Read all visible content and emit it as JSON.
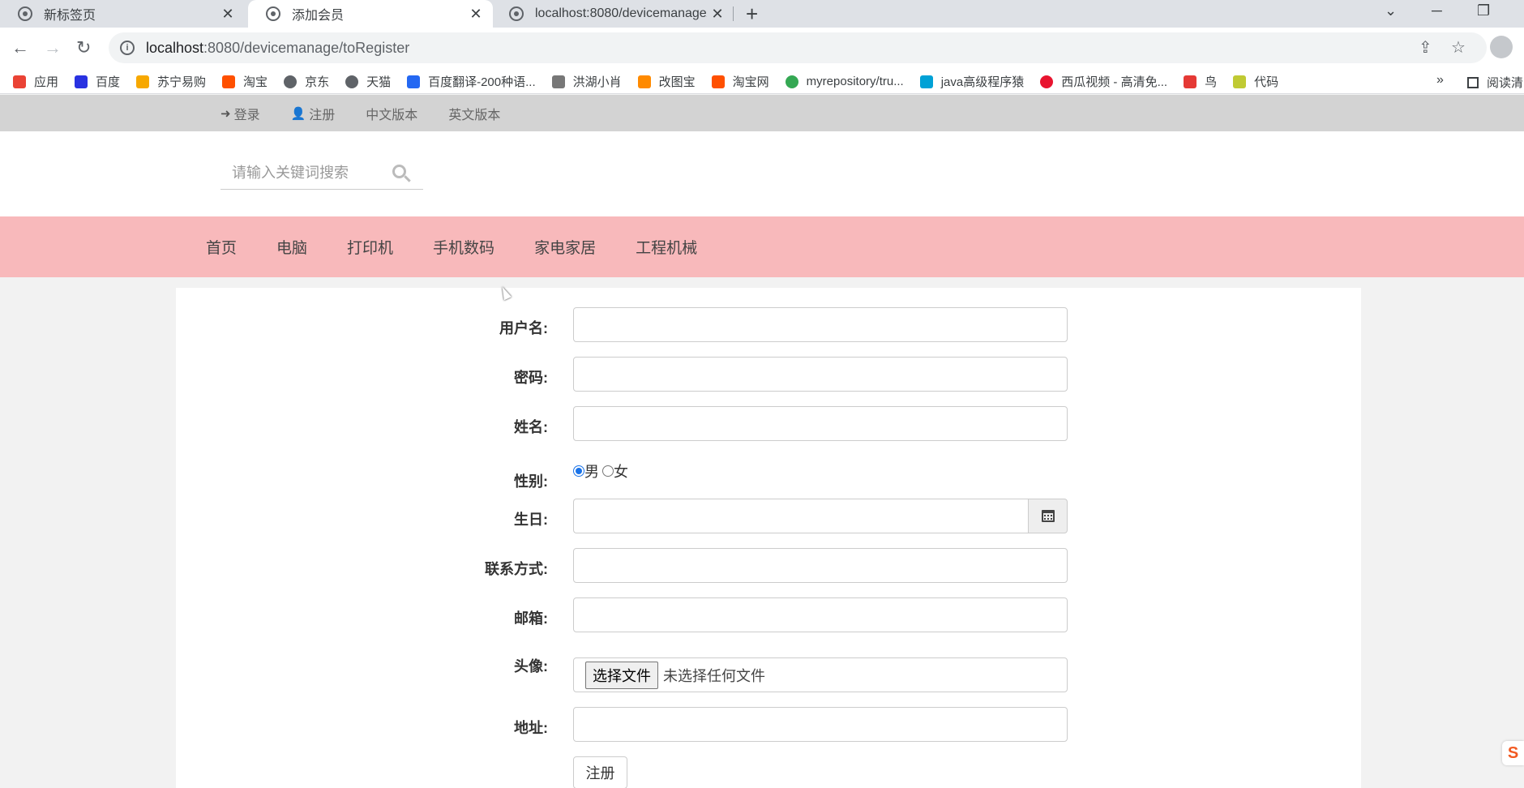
{
  "browser": {
    "tabs": [
      {
        "title": "新标签页",
        "active": false
      },
      {
        "title": "添加会员",
        "active": true
      },
      {
        "title": "localhost:8080/devicemanage/",
        "active": false
      }
    ],
    "url_host": "localhost",
    "url_rest": ":8080/devicemanage/toRegister",
    "bookmarks": [
      {
        "label": "应用",
        "icon": "apps-icon",
        "color": "#ea4335"
      },
      {
        "label": "百度",
        "icon": "baidu-icon",
        "color": "#2932e1"
      },
      {
        "label": "苏宁易购",
        "icon": "suning-icon",
        "color": "#f7a800"
      },
      {
        "label": "淘宝",
        "icon": "taobao-icon",
        "color": "#ff5000"
      },
      {
        "label": "京东",
        "icon": "globe-icon",
        "color": "#5f6368"
      },
      {
        "label": "天猫",
        "icon": "globe-icon",
        "color": "#5f6368"
      },
      {
        "label": "百度翻译-200种语...",
        "icon": "translate-icon",
        "color": "#2468f2"
      },
      {
        "label": "洪湖小肖",
        "icon": "feather-icon",
        "color": "#777777"
      },
      {
        "label": "改图宝",
        "icon": "gaitubao-icon",
        "color": "#ff8a00"
      },
      {
        "label": "淘宝网",
        "icon": "taobao-icon",
        "color": "#ff5000"
      },
      {
        "label": "myrepository/tru...",
        "icon": "chrome-icon",
        "color": "#34a853"
      },
      {
        "label": "java高级程序猿",
        "icon": "bilibili-icon",
        "color": "#00a1d6"
      },
      {
        "label": "西瓜视频 - 高清免...",
        "icon": "xigua-icon",
        "color": "#e8142f"
      },
      {
        "label": "鸟",
        "icon": "bird-icon",
        "color": "#e53935"
      },
      {
        "label": "代码",
        "icon": "leaf-icon",
        "color": "#c0ca33"
      }
    ],
    "bookmarks_more": "»",
    "reading_list": "阅读清"
  },
  "site": {
    "top_links": [
      {
        "label": "登录",
        "icon": "login-icon",
        "glyph": "➜"
      },
      {
        "label": "注册",
        "icon": "user-icon",
        "glyph": "👤"
      },
      {
        "label": "中文版本",
        "icon": "",
        "glyph": ""
      },
      {
        "label": "英文版本",
        "icon": "",
        "glyph": ""
      }
    ],
    "search_placeholder": "请输入关键词搜索",
    "categories": [
      "首页",
      "电脑",
      "打印机",
      "手机数码",
      "家电家居",
      "工程机械"
    ]
  },
  "form": {
    "username_label": "用户名:",
    "password_label": "密码:",
    "name_label": "姓名:",
    "gender_label": "性别:",
    "gender_options": [
      "男",
      "女"
    ],
    "gender_selected": "男",
    "birthday_label": "生日:",
    "contact_label": "联系方式:",
    "email_label": "邮箱:",
    "avatar_label": "头像:",
    "file_button": "选择文件",
    "file_status": "未选择任何文件",
    "address_label": "地址:",
    "submit_label": "注册"
  }
}
